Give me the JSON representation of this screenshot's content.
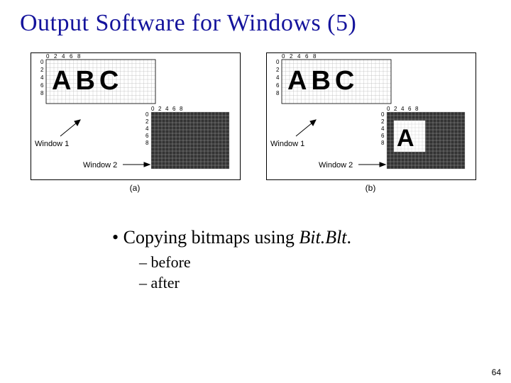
{
  "title": "Output Software for Windows (5)",
  "figure": {
    "axis_ticks": [
      "0",
      "2",
      "4",
      "6",
      "8"
    ],
    "window1_label": "Window 1",
    "window2_label": "Window 2",
    "letters_top": "ABC",
    "letter_copied": "A",
    "caption_a": "(a)",
    "caption_b": "(b)"
  },
  "bullets": {
    "main_prefix": "Copying bitmaps using ",
    "main_emph": "Bit.Blt",
    "main_suffix": ".",
    "sub1": "– before",
    "sub2": "– after"
  },
  "page_number": "64"
}
